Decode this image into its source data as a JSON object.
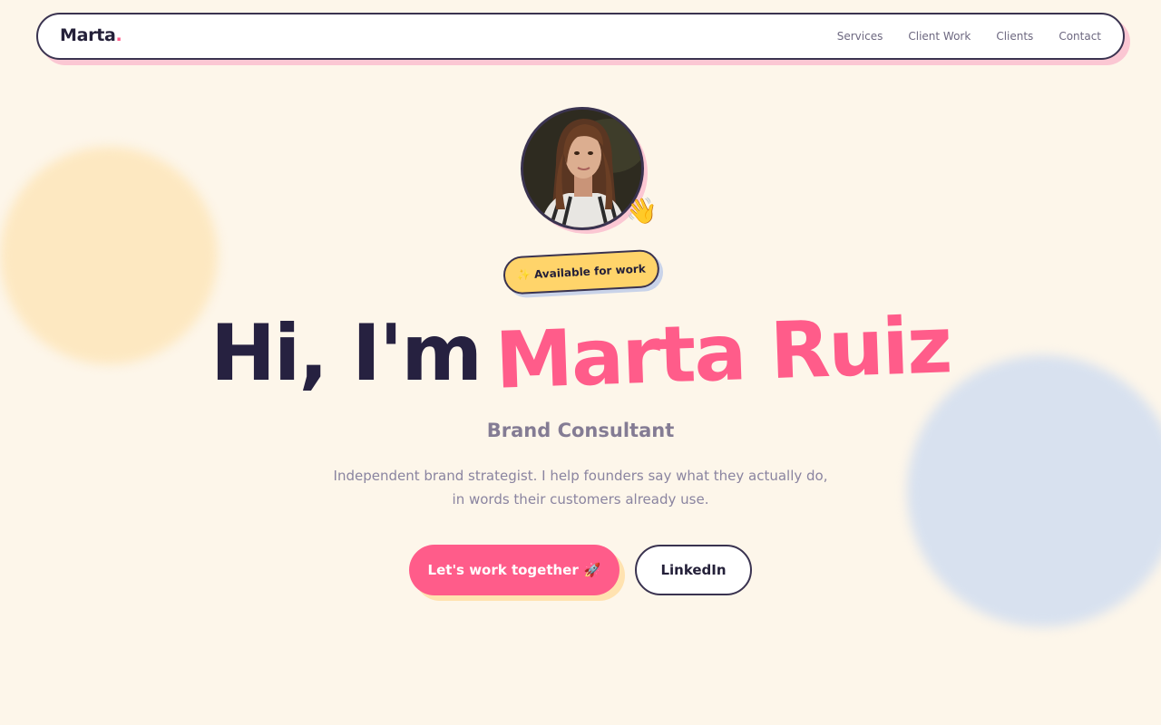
{
  "nav": {
    "logo_text": "Marta",
    "logo_dot": ".",
    "links": [
      "Services",
      "Client Work",
      "Clients",
      "Contact"
    ]
  },
  "hero": {
    "wave_emoji": "👋",
    "badge": {
      "icon": "✨",
      "label": "Available for work"
    },
    "greeting": "Hi, I'm",
    "name": "Marta Ruiz",
    "role": "Brand Consultant",
    "description": "Independent brand strategist. I help founders say what they actually do, in words their customers already use.",
    "cta": {
      "label": "Let's work together",
      "icon": "🚀"
    },
    "secondary": {
      "label": "LinkedIn"
    }
  },
  "colors": {
    "accent": "#ff5c8a",
    "ink": "#262140",
    "badge": "#ffd46a",
    "background": "#fdf6ea"
  }
}
